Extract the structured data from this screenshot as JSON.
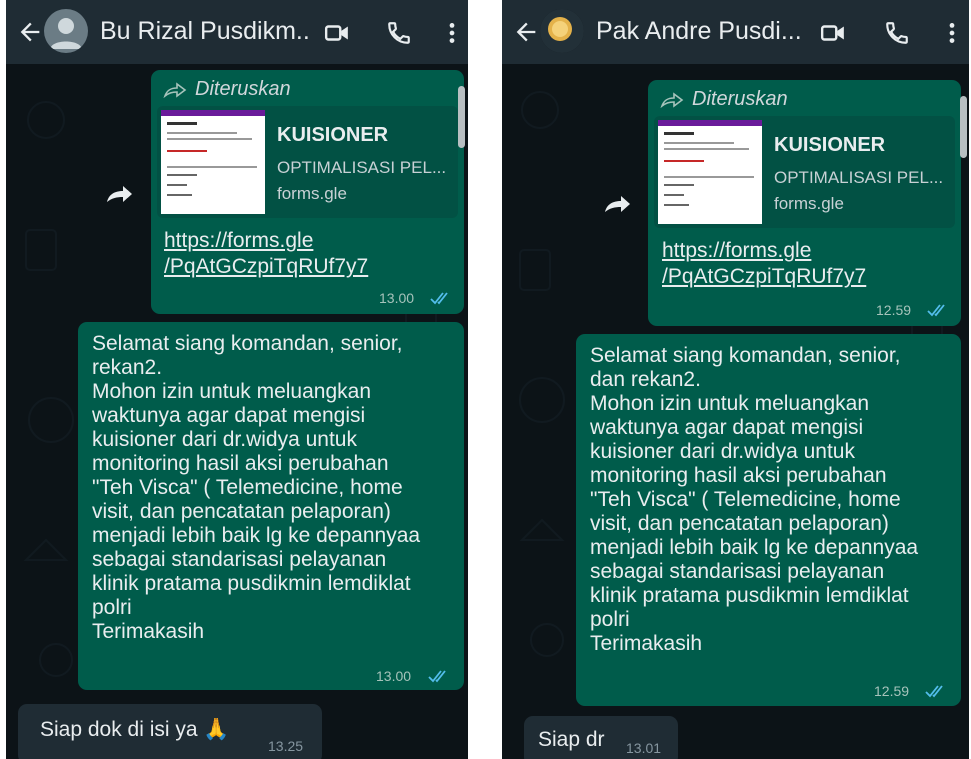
{
  "left": {
    "contact_name": "Bu Rizal Pusdikm...",
    "forwarded_label": "Diteruskan",
    "preview": {
      "title": "KUISIONER",
      "description": "OPTIMALISASI PEL...",
      "host": "forms.gle"
    },
    "link_line1": "https://forms.gle",
    "link_line2": "/PqAtGCzpiTqRUf7y7",
    "link_time": "13.00",
    "message": "Selamat siang komandan, senior,\nrekan2.\nMohon izin untuk meluangkan\nwaktunya agar dapat mengisi\nkuisioner dari dr.widya untuk\nmonitoring hasil aksi perubahan\n\"Teh Visca\" ( Telemedicine, home\nvisit, dan pencatatan pelaporan)\nmenjadi lebih baik lg ke depannyaa\nsebagai standarisasi pelayanan\nklinik pratama pusdikmin lemdiklat\npolri\nTerimakasih",
    "message_time": "13.00",
    "reply": "Siap dok di isi ya 🙏",
    "reply_time": "13.25"
  },
  "right": {
    "contact_name": "Pak Andre Pusdi...",
    "forwarded_label": "Diteruskan",
    "preview": {
      "title": "KUISIONER",
      "description": "OPTIMALISASI PEL...",
      "host": "forms.gle"
    },
    "link_line1": "https://forms.gle",
    "link_line2": "/PqAtGCzpiTqRUf7y7",
    "link_time": "12.59",
    "message": "Selamat siang komandan, senior,\ndan rekan2.\nMohon izin untuk meluangkan\nwaktunya agar dapat mengisi\nkuisioner dari dr.widya untuk\nmonitoring hasil aksi perubahan\n\"Teh Visca\" ( Telemedicine, home\nvisit, dan pencatatan pelaporan)\nmenjadi lebih baik lg ke depannyaa\nsebagai standarisasi pelayanan\nklinik pratama pusdikmin lemdiklat\npolri\nTerimakasih",
    "message_time": "12.59",
    "reply": "Siap dr",
    "reply_time": "13.01"
  },
  "colors": {
    "header": "#1f2c34",
    "chat_bg": "#0c1317",
    "outgoing": "#005c4b",
    "incoming": "#1f2c34",
    "read_ticks": "#53bdeb"
  },
  "icons": [
    "back-arrow-icon",
    "avatar",
    "video-call-icon",
    "voice-call-icon",
    "more-options-icon",
    "forward-icon",
    "double-check-icon"
  ]
}
